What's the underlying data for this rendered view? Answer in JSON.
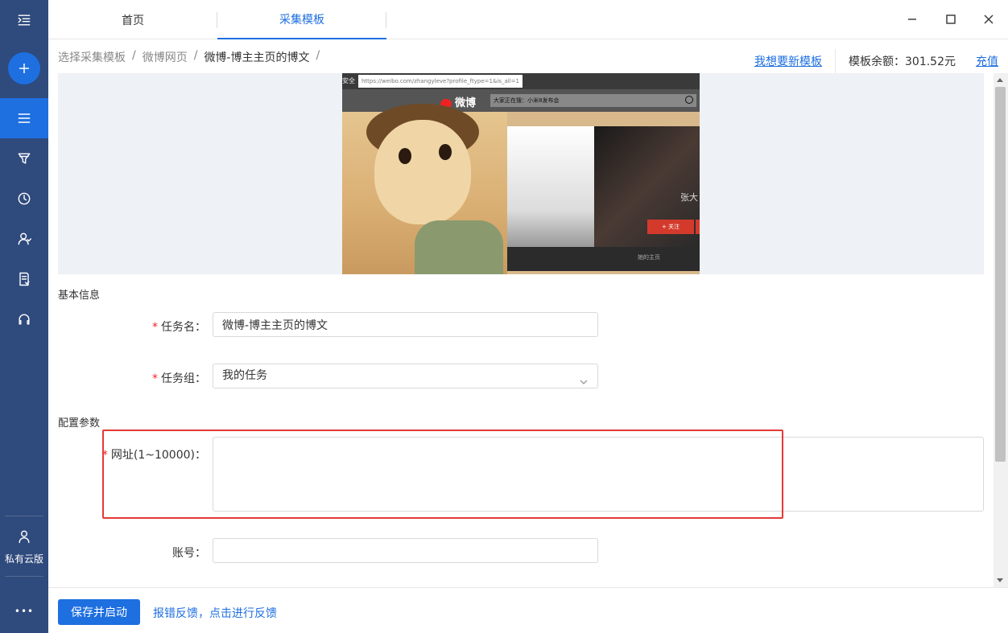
{
  "tabs": [
    {
      "label": "首页"
    },
    {
      "label": "采集模板"
    }
  ],
  "breadcrumb": {
    "items": [
      "选择采集模板",
      "微博网页",
      "微博-博主主页的博文"
    ],
    "separator": "/"
  },
  "header_right": {
    "request_template": "我想要新模板",
    "balance_label": "模板余额：",
    "balance_value": "301.52元",
    "recharge": "充值"
  },
  "preview": {
    "security_label": "安全",
    "url": "https://weibo.com/zhangyleve?profile_ftype=1&is_all=1",
    "logo_text": "微博",
    "search_text": "大家正在搜：小米8发布会",
    "profile_name": "张大",
    "follow_label": "+ 关注",
    "home_label": "她的主页"
  },
  "form": {
    "section_basic": "基本信息",
    "task_name": {
      "label": "任务名",
      "value": "微博-博主主页的博文",
      "required": true
    },
    "task_group": {
      "label": "任务组",
      "value": "我的任务",
      "required": true
    },
    "section_config": "配置参数",
    "url_field": {
      "label": "网址(1~10000)",
      "value": "",
      "required": true
    },
    "account": {
      "label": "账号",
      "value": "",
      "required": false
    }
  },
  "sidebar": {
    "private_cloud_label": "私有云版",
    "more_label": "•••"
  },
  "footer": {
    "save_start": "保存并启动",
    "feedback": "报错反馈，点击进行反馈"
  },
  "colors": {
    "sidebar_bg": "#2f4a7c",
    "accent": "#1e6fe0",
    "required": "#f5222d",
    "highlight": "#e53935"
  }
}
